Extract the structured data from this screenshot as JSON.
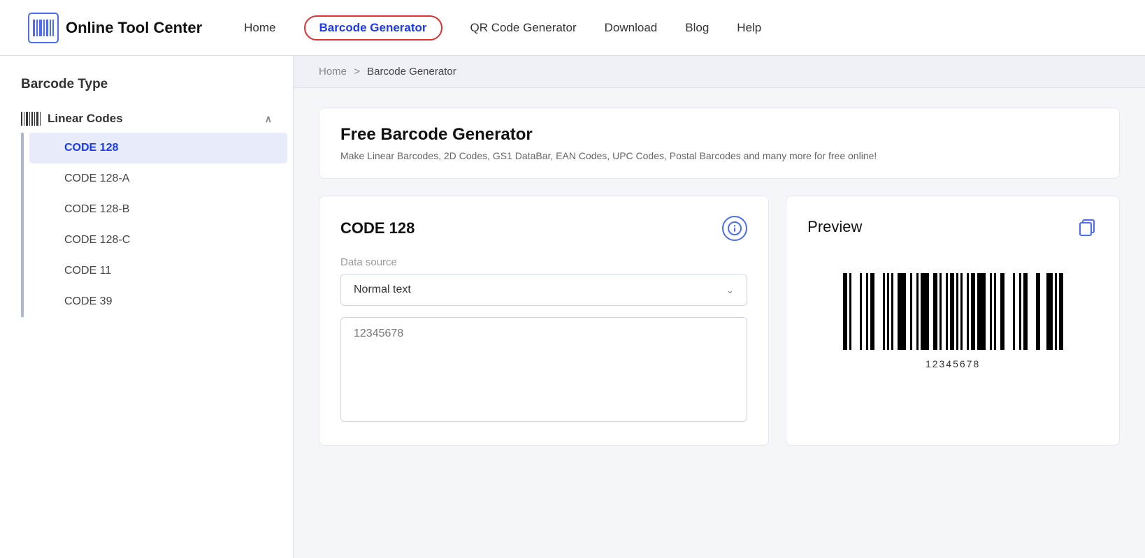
{
  "header": {
    "logo_text": "Online Tool Center",
    "nav_items": [
      {
        "label": "Home",
        "active": false
      },
      {
        "label": "Barcode Generator",
        "active": true
      },
      {
        "label": "QR Code Generator",
        "active": false
      },
      {
        "label": "Download",
        "active": false
      },
      {
        "label": "Blog",
        "active": false
      },
      {
        "label": "Help",
        "active": false
      }
    ]
  },
  "sidebar": {
    "title": "Barcode Type",
    "section": {
      "label": "Linear Codes",
      "icon": "barcode-icon"
    },
    "items": [
      {
        "label": "CODE 128",
        "active": true
      },
      {
        "label": "CODE 128-A",
        "active": false
      },
      {
        "label": "CODE 128-B",
        "active": false
      },
      {
        "label": "CODE 128-C",
        "active": false
      },
      {
        "label": "CODE 11",
        "active": false
      },
      {
        "label": "CODE 39",
        "active": false
      }
    ]
  },
  "breadcrumb": {
    "home": "Home",
    "separator": ">",
    "current": "Barcode Generator"
  },
  "page_header": {
    "title": "Free Barcode Generator",
    "description": "Make Linear Barcodes, 2D Codes, GS1 DataBar, EAN Codes, UPC Codes, Postal Barcodes and many more for free online!"
  },
  "left_panel": {
    "title": "CODE 128",
    "data_source_label": "Data source",
    "dropdown_value": "Normal text",
    "textarea_placeholder": "12345678"
  },
  "right_panel": {
    "title": "Preview",
    "barcode_value": "12345678",
    "barcode_data": [
      3,
      1,
      2,
      1,
      1,
      2,
      3,
      1,
      1,
      2,
      2,
      1,
      1,
      3,
      1,
      2,
      2,
      1,
      3,
      1,
      1,
      2,
      1,
      2,
      2,
      3,
      1,
      1,
      2,
      1,
      1,
      2,
      1,
      3,
      2,
      1,
      1,
      2,
      3,
      1,
      2,
      1,
      1,
      2,
      2,
      1,
      1,
      3,
      2,
      1,
      1,
      2,
      1,
      2,
      2,
      1,
      3,
      1,
      1,
      2,
      2,
      1,
      1,
      2,
      3,
      1
    ]
  }
}
